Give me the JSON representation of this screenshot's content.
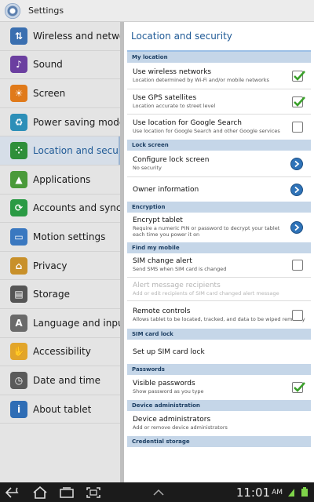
{
  "app": {
    "title": "Settings"
  },
  "sidebar": {
    "items": [
      {
        "label": "Wireless and networks",
        "icon": "wireless-icon",
        "color": "#3a6fb0"
      },
      {
        "label": "Sound",
        "icon": "sound-icon",
        "color": "#6b3fa0"
      },
      {
        "label": "Screen",
        "icon": "screen-icon",
        "color": "#e07a1a"
      },
      {
        "label": "Power saving mode",
        "icon": "power-saving-icon",
        "color": "#2d8fb8"
      },
      {
        "label": "Location and security",
        "icon": "location-icon",
        "color": "#2f8f3a"
      },
      {
        "label": "Applications",
        "icon": "applications-icon",
        "color": "#4a9a3a"
      },
      {
        "label": "Accounts and sync",
        "icon": "accounts-sync-icon",
        "color": "#2a9a44"
      },
      {
        "label": "Motion settings",
        "icon": "motion-icon",
        "color": "#3a78c0"
      },
      {
        "label": "Privacy",
        "icon": "privacy-icon",
        "color": "#c8902a"
      },
      {
        "label": "Storage",
        "icon": "storage-icon",
        "color": "#555555"
      },
      {
        "label": "Language and input",
        "icon": "language-icon",
        "color": "#6a6a6a"
      },
      {
        "label": "Accessibility",
        "icon": "accessibility-icon",
        "color": "#e2a52a"
      },
      {
        "label": "Date and time",
        "icon": "clock-icon",
        "color": "#5a5a5a"
      },
      {
        "label": "About tablet",
        "icon": "info-icon",
        "color": "#2f6db5"
      }
    ],
    "selected_index": 4
  },
  "panel": {
    "title": "Location and security",
    "sections": [
      {
        "header": "My location",
        "rows": [
          {
            "title": "Use wireless networks",
            "sub": "Location determined by Wi-Fi and/or mobile networks",
            "control": "check",
            "checked": true,
            "h": 34
          },
          {
            "title": "Use GPS satellites",
            "sub": "Location accurate to street level",
            "control": "check",
            "checked": true,
            "h": 32
          },
          {
            "title": "Use location for Google Search",
            "sub": "Use location for Google Search and other Google services",
            "control": "check",
            "checked": false,
            "h": 32
          }
        ]
      },
      {
        "header": "Lock screen",
        "rows": [
          {
            "title": "Configure lock screen",
            "sub": "No security",
            "control": "arrow",
            "h": 34
          },
          {
            "title": "Owner information",
            "sub": "",
            "control": "arrow",
            "h": 31
          }
        ]
      },
      {
        "header": "Encryption",
        "rows": [
          {
            "title": "Encrypt tablet",
            "sub": "Require a numeric PIN or password to decrypt your tablet each time you power it on",
            "control": "arrow",
            "h": 38
          }
        ]
      },
      {
        "header": "Find my mobile",
        "rows": [
          {
            "title": "SIM change alert",
            "sub": "Send SMS when SIM card is changed",
            "control": "check",
            "checked": false,
            "h": 31
          },
          {
            "title": "Alert message recipients",
            "sub": "Add or edit recipients of SIM card changed alert message",
            "control": "none",
            "disabled": true,
            "h": 30
          },
          {
            "title": "Remote controls",
            "sub": "Allows tablet to be located, tracked, and data to be wiped remotely",
            "control": "check",
            "checked": false,
            "h": 35
          }
        ]
      },
      {
        "header": "SIM card lock",
        "rows": [
          {
            "title": "Set up SIM card lock",
            "sub": "",
            "control": "none",
            "h": 31
          }
        ]
      },
      {
        "header": "Passwords",
        "rows": [
          {
            "title": "Visible passwords",
            "sub": "Show password as you type",
            "control": "check",
            "checked": true,
            "h": 32
          }
        ]
      },
      {
        "header": "Device administration",
        "rows": [
          {
            "title": "Device administrators",
            "sub": "Add or remove device administrators",
            "control": "none",
            "h": 32
          }
        ]
      },
      {
        "header": "Credential storage",
        "rows": []
      }
    ]
  },
  "status": {
    "time": "11:01",
    "ampm": "AM"
  },
  "colors": {
    "accent": "#1f5a96",
    "check": "#3aa02a"
  }
}
